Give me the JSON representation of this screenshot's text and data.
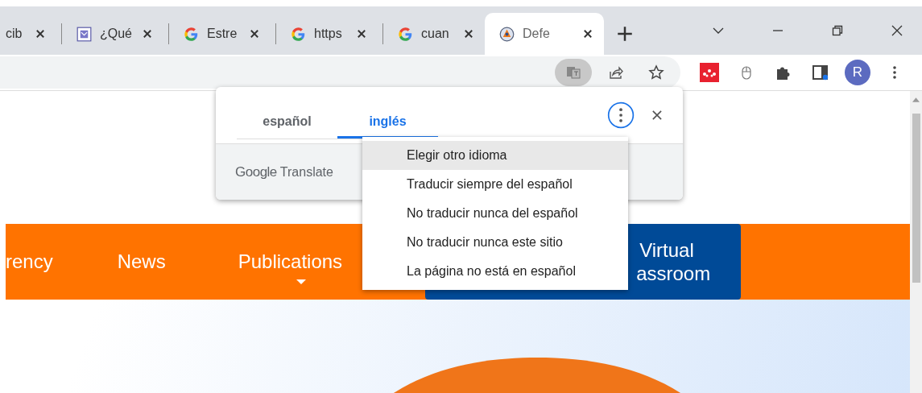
{
  "tabs": [
    {
      "title": "cib",
      "kind": "plain",
      "selected": false
    },
    {
      "title": "¿Qué",
      "kind": "app",
      "selected": false
    },
    {
      "title": "Estre",
      "kind": "google",
      "selected": false
    },
    {
      "title": "https",
      "kind": "google",
      "selected": false
    },
    {
      "title": "cuan",
      "kind": "google",
      "selected": false
    },
    {
      "title": "Defe",
      "kind": "emblem",
      "selected": true
    }
  ],
  "toolbar": {
    "translate_active": true,
    "avatar": "R"
  },
  "translate_popup": {
    "tabs": [
      {
        "label": "español",
        "selected": false
      },
      {
        "label": "inglés",
        "selected": true
      }
    ],
    "brand": "Google",
    "product": "Translate",
    "menu": [
      {
        "label": "Elegir otro idioma",
        "selected": true
      },
      {
        "label": "Traducir siempre del español",
        "selected": false
      },
      {
        "label": "No traducir nunca del español",
        "selected": false
      },
      {
        "label": "No traducir nunca este sitio",
        "selected": false
      },
      {
        "label": "La página no está en español",
        "selected": false
      }
    ]
  },
  "page": {
    "nav": [
      {
        "label": "rency",
        "kind": "link"
      },
      {
        "label": "News",
        "kind": "link"
      },
      {
        "label": "Publications",
        "kind": "dropdown"
      }
    ],
    "cta": [
      "Virtual",
      "assroom"
    ]
  }
}
